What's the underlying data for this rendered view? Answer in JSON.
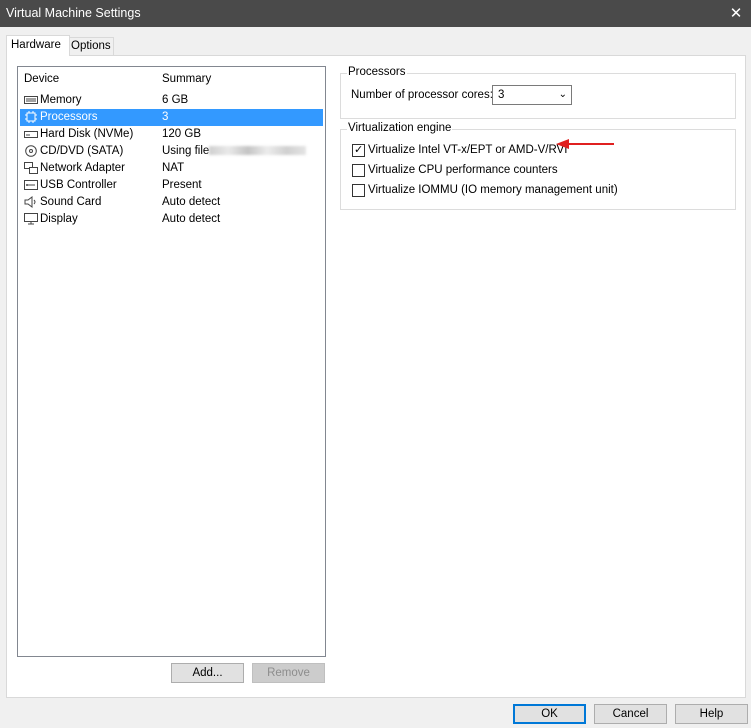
{
  "window": {
    "title": "Virtual Machine Settings",
    "close_glyph": "✕"
  },
  "tabs": [
    {
      "label": "Hardware",
      "active": true
    },
    {
      "label": "Options",
      "active": false
    }
  ],
  "device_list": {
    "headers": {
      "device": "Device",
      "summary": "Summary"
    },
    "rows": [
      {
        "icon": "memory-icon",
        "device": "Memory",
        "summary": "6 GB",
        "selected": false
      },
      {
        "icon": "processor-icon",
        "device": "Processors",
        "summary": "3",
        "selected": true
      },
      {
        "icon": "hard-disk-icon",
        "device": "Hard Disk (NVMe)",
        "summary": "120 GB",
        "selected": false
      },
      {
        "icon": "cd-dvd-icon",
        "device": "CD/DVD (SATA)",
        "summary": "Using file",
        "selected": false
      },
      {
        "icon": "network-adapter-icon",
        "device": "Network Adapter",
        "summary": "NAT",
        "selected": false
      },
      {
        "icon": "usb-controller-icon",
        "device": "USB Controller",
        "summary": "Present",
        "selected": false
      },
      {
        "icon": "sound-card-icon",
        "device": "Sound Card",
        "summary": "Auto detect",
        "selected": false
      },
      {
        "icon": "display-icon",
        "device": "Display",
        "summary": "Auto detect",
        "selected": false
      }
    ],
    "add_label": "Add...",
    "remove_label": "Remove"
  },
  "processors": {
    "legend": "Processors",
    "cores_label": "Number of processor cores:",
    "cores_value": "3"
  },
  "virtualization": {
    "legend": "Virtualization engine",
    "options": [
      {
        "label": "Virtualize Intel VT-x/EPT or AMD-V/RVI",
        "checked": true
      },
      {
        "label": "Virtualize CPU performance counters",
        "checked": false
      },
      {
        "label": "Virtualize IOMMU (IO memory management unit)",
        "checked": false
      }
    ]
  },
  "annotation": {
    "color": "#e02020"
  },
  "footer": {
    "ok_label": "OK",
    "cancel_label": "Cancel",
    "help_label": "Help"
  },
  "colors": {
    "selection": "#3399ff",
    "titlebar": "#4a4a4a",
    "default_button_border": "#0078d7"
  }
}
